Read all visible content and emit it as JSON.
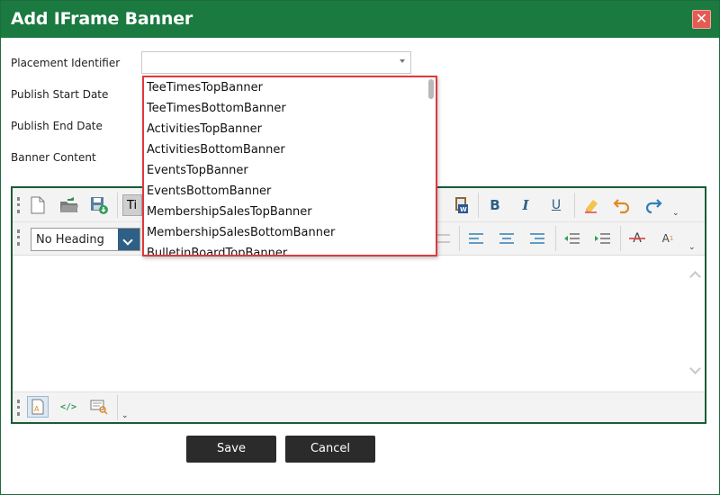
{
  "dialog": {
    "title": "Add IFrame Banner",
    "close_symbol": "✕"
  },
  "form": {
    "placement_label": "Placement Identifier",
    "start_label": "Publish Start Date",
    "end_label": "Publish End Date",
    "content_label": "Banner Content",
    "placement_value": ""
  },
  "dropdown": {
    "items": [
      "TeeTimesTopBanner",
      "TeeTimesBottomBanner",
      "ActivitiesTopBanner",
      "ActivitiesBottomBanner",
      "EventsTopBanner",
      "EventsBottomBanner",
      "MembershipSalesTopBanner",
      "MembershipSalesBottomBanner",
      "BulletinBoardTopBanner"
    ]
  },
  "editor": {
    "font_label_partial": "Ti",
    "heading_value": "No Heading",
    "bold_glyph": "B",
    "italic_glyph": "I",
    "underline_glyph": "U",
    "strike_glyph": "A",
    "superscript_glyph": "A",
    "more_glyph": "⌄"
  },
  "buttons": {
    "save": "Save",
    "cancel": "Cancel"
  },
  "colors": {
    "header": "#1a7a40",
    "close": "#e35b52",
    "highlight": "#e0383d",
    "button": "#2b2b2b"
  }
}
